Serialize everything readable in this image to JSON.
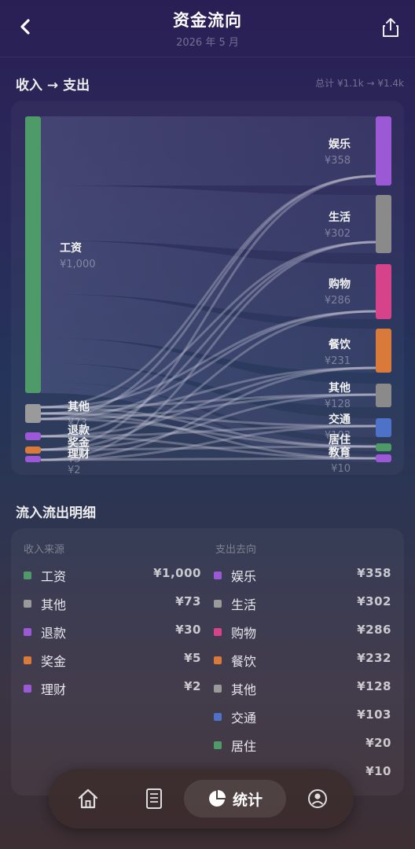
{
  "header": {
    "title": "资金流向",
    "subtitle": "2026 年 5 月"
  },
  "flow": {
    "section_title": "收入 → 支出",
    "total": "总计 ¥1.1k → ¥1.4k"
  },
  "sankey": {
    "sources": [
      {
        "name": "工资",
        "value": "¥1,000",
        "color": "#4e9a68"
      },
      {
        "name": "其他",
        "value": "¥73",
        "color": "#9a9a9a"
      },
      {
        "name": "退款",
        "value": "¥30",
        "color": "#9b59d6"
      },
      {
        "name": "奖金",
        "value": "¥5",
        "color": "#d9793a"
      },
      {
        "name": "理财",
        "value": "¥2",
        "color": "#9b59d6"
      }
    ],
    "targets": [
      {
        "name": "娱乐",
        "value": "¥358",
        "color": "#9b59d6"
      },
      {
        "name": "生活",
        "value": "¥302",
        "color": "#8a8a8a"
      },
      {
        "name": "购物",
        "value": "¥286",
        "color": "#d6438a"
      },
      {
        "name": "餐饮",
        "value": "¥231",
        "color": "#d9793a"
      },
      {
        "name": "其他",
        "value": "¥128",
        "color": "#8a8a8a"
      },
      {
        "name": "交通",
        "value": "¥103",
        "color": "#4f72c9"
      },
      {
        "name": "居住",
        "value": "¥20",
        "color": "#4e9a68"
      },
      {
        "name": "教育",
        "value": "¥10",
        "color": "#9b59d6"
      }
    ]
  },
  "detail": {
    "section_title": "流入流出明细",
    "income_header": "收入来源",
    "expense_header": "支出去向",
    "income": [
      {
        "name": "工资",
        "amount": "¥1,000",
        "color": "#4e9a68"
      },
      {
        "name": "其他",
        "amount": "¥73",
        "color": "#9a9a9a"
      },
      {
        "name": "退款",
        "amount": "¥30",
        "color": "#9b59d6"
      },
      {
        "name": "奖金",
        "amount": "¥5",
        "color": "#d9793a"
      },
      {
        "name": "理财",
        "amount": "¥2",
        "color": "#9b59d6"
      }
    ],
    "expense": [
      {
        "name": "娱乐",
        "amount": "¥358",
        "color": "#9b59d6"
      },
      {
        "name": "生活",
        "amount": "¥302",
        "color": "#9a9a9a"
      },
      {
        "name": "购物",
        "amount": "¥286",
        "color": "#d6438a"
      },
      {
        "name": "餐饮",
        "amount": "¥232",
        "color": "#d9793a"
      },
      {
        "name": "其他",
        "amount": "¥128",
        "color": "#9a9a9a"
      },
      {
        "name": "交通",
        "amount": "¥103",
        "color": "#4f72c9"
      },
      {
        "name": "居住",
        "amount": "¥20",
        "color": "#4e9a68"
      },
      {
        "name": "",
        "amount": "¥10",
        "color": ""
      }
    ]
  },
  "tabbar": {
    "active_label": "统计",
    "icons": [
      "home-icon",
      "ledger-icon",
      "stats-pie-icon",
      "profile-icon"
    ]
  }
}
